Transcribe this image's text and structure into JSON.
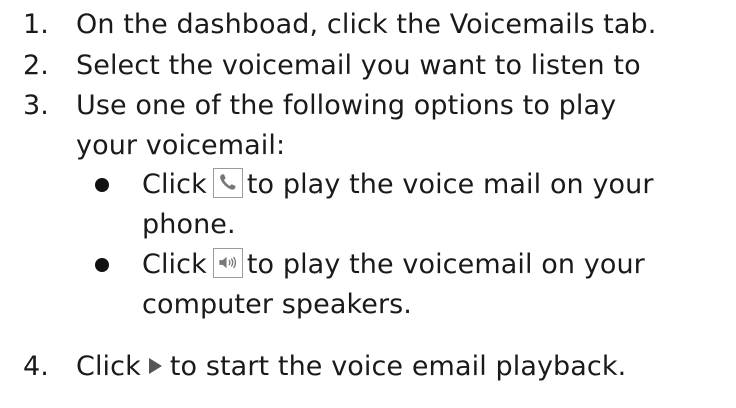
{
  "steps": [
    {
      "number": "1.",
      "text": "On the dashboad, click the Voicemails tab."
    },
    {
      "number": "2.",
      "text": "Select the voicemail you want to listen to"
    },
    {
      "number": "3.",
      "text_line1": "Use one of the following options to play",
      "text_line2": "your voicemail:"
    },
    {
      "number": "4.",
      "prefix": "Click",
      "suffix": "to start the voice email playback."
    }
  ],
  "options": [
    {
      "prefix": "Click",
      "suffix": "to play the voice mail on your",
      "line2": "phone.",
      "icon": "phone-icon"
    },
    {
      "prefix": "Click",
      "suffix": "to play the voicemail on your",
      "line2": "computer speakers.",
      "icon": "speaker-icon"
    }
  ],
  "play_icon": "play-icon"
}
